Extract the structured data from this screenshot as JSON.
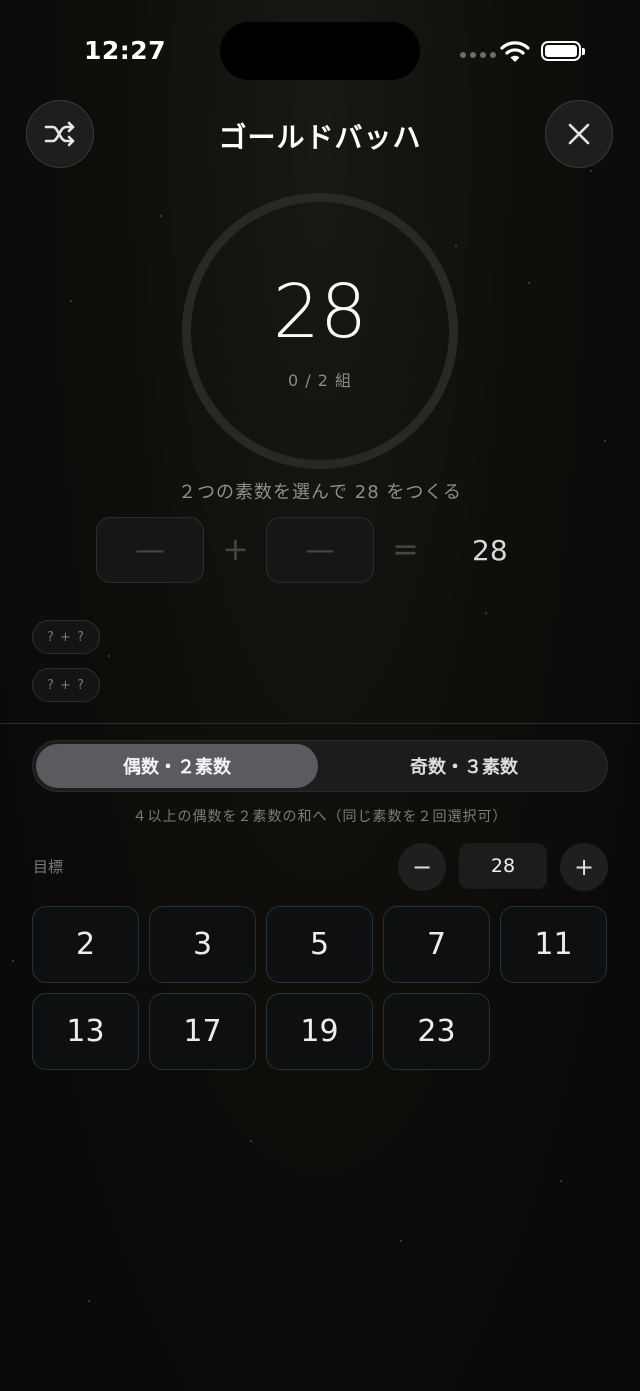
{
  "status_bar": {
    "time": "12:27"
  },
  "header": {
    "title": "ゴールドバッハ"
  },
  "ring": {
    "value": "28",
    "progress_text": "0 / 2 組",
    "progress_fraction": 0
  },
  "instruction": "２つの素数を選んで 28 をつくる",
  "equation": {
    "slot_1": "—",
    "slot_2": "—",
    "plus": "+",
    "equals": "=",
    "target": "28"
  },
  "pairs": [
    "? + ?",
    "? + ?"
  ],
  "modes": {
    "items": [
      "偶数・２素数",
      "奇数・３素数"
    ],
    "selected_index": 0
  },
  "mode_description": "４以上の偶数を２素数の和へ（同じ素数を２回選択可）",
  "target": {
    "label": "目標",
    "value": "28",
    "minus": "−",
    "plus": "+"
  },
  "primes": [
    "2",
    "3",
    "5",
    "7",
    "11",
    "13",
    "17",
    "19",
    "23"
  ],
  "colors": {
    "accent_border": "#233236",
    "ring_track": "#2a2826",
    "selected_segment": "#5b5b5f"
  }
}
